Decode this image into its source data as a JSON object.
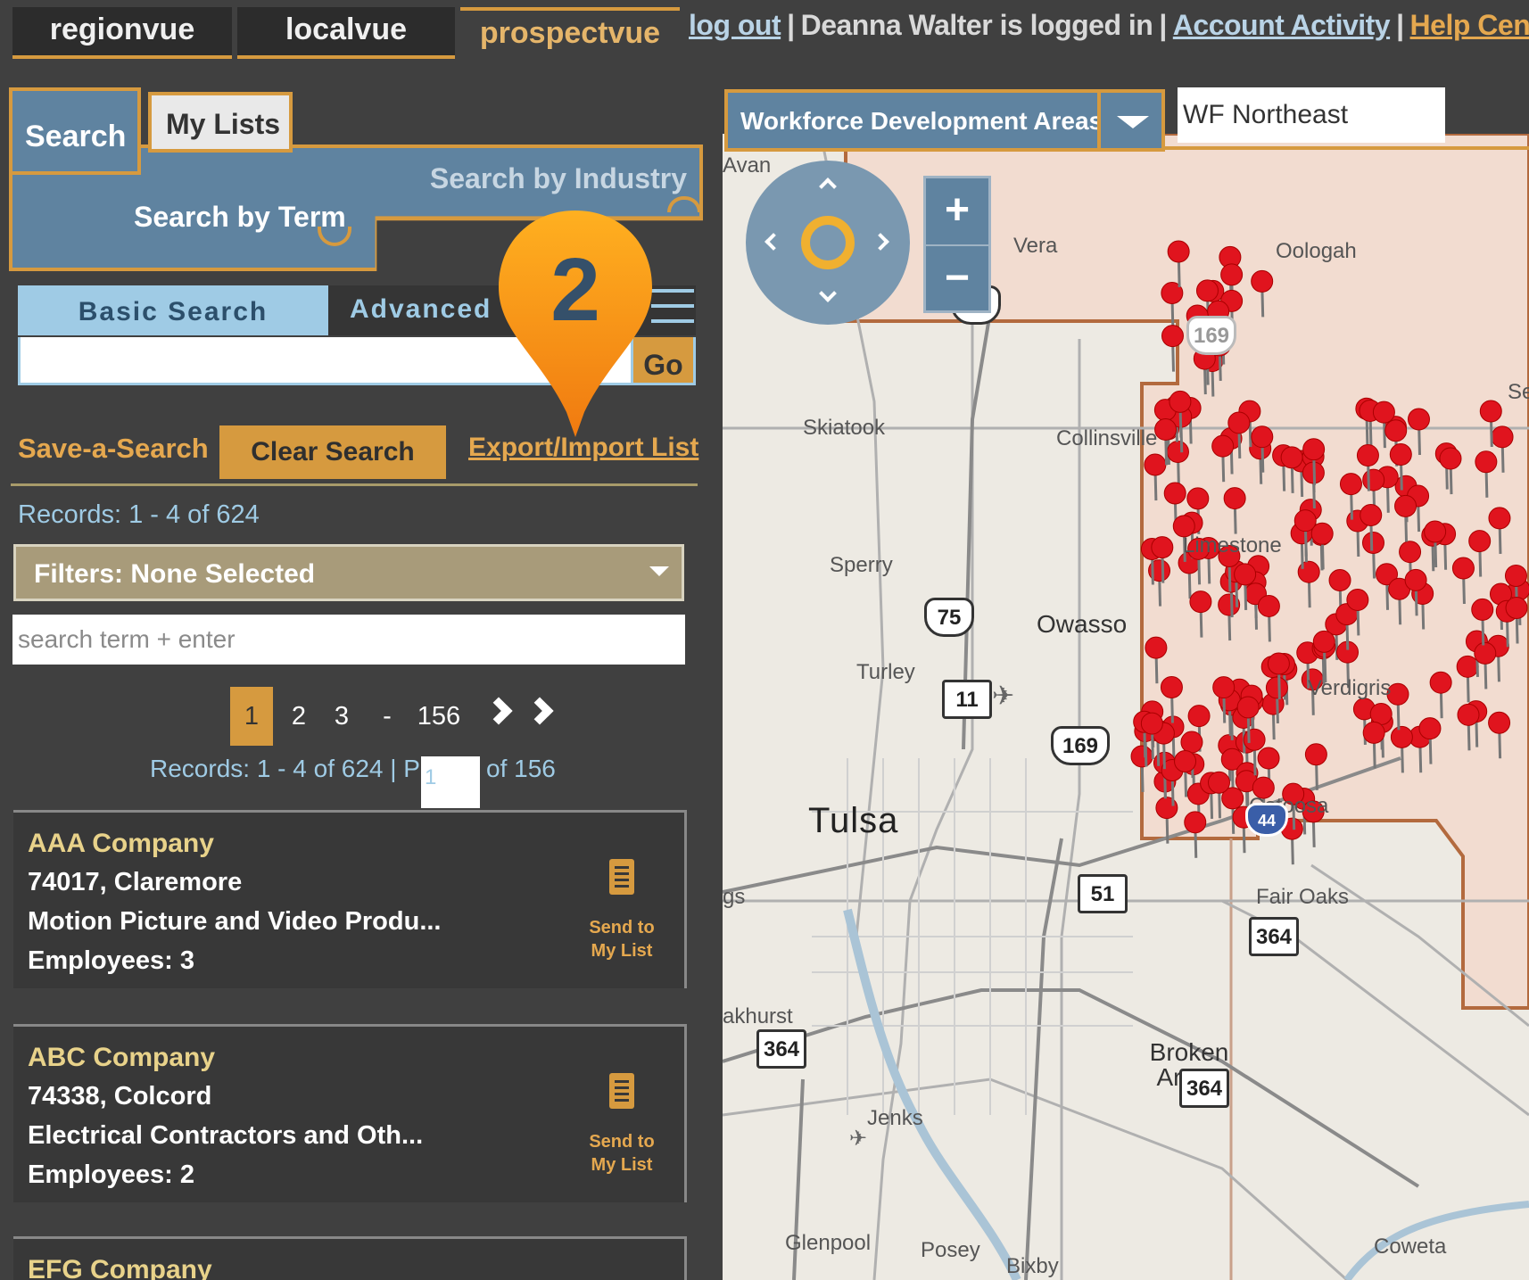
{
  "top_nav": {
    "tabs": [
      {
        "label": "regionvue"
      },
      {
        "label": "localvue"
      },
      {
        "label": "prospectvue"
      }
    ],
    "logout": "log out",
    "user_status": "Deanna Walter is logged in",
    "account_activity": "Account Activity",
    "help_center": "Help Center"
  },
  "panel_tabs": {
    "search": "Search",
    "my_lists": "My Lists"
  },
  "search_modes": {
    "by_industry": "Search by Industry",
    "by_term": "Search by Term"
  },
  "search_type_tabs": {
    "basic": "Basic Search",
    "advanced": "Advanced"
  },
  "search_box": {
    "value": "",
    "go": "Go"
  },
  "actions": {
    "save_search": "Save-a-Search",
    "clear_search": "Clear Search",
    "export_import": "Export/Import List"
  },
  "callout": {
    "number": "2"
  },
  "records_top": "Records: 1 - 4 of 624",
  "filters": {
    "label": "Filters: None Selected"
  },
  "term_input": {
    "placeholder": "search term + enter"
  },
  "pagination": {
    "pages": [
      "1",
      "2",
      "3",
      "-",
      "156"
    ],
    "current": "1"
  },
  "records_line": {
    "text": "Records: 1 - 4 of 624 | Page",
    "page_value": "1",
    "of_text": "of 156"
  },
  "results": [
    {
      "name": "AAA Company",
      "location": "74017, Claremore",
      "industry": "Motion Picture and Video Produ...",
      "employees": "Employees: 3",
      "send_line1": "Send to",
      "send_line2": "My List"
    },
    {
      "name": "ABC Company",
      "location": "74338, Colcord",
      "industry": "Electrical Contractors and Oth...",
      "employees": "Employees: 2",
      "send_line1": "Send to",
      "send_line2": "My List"
    },
    {
      "name": "EFG Company"
    }
  ],
  "map": {
    "region_type": "Workforce Development Areas",
    "region_value": "WF Northeast",
    "zoom_in": "+",
    "zoom_out": "−",
    "places": [
      "Avan",
      "Vera",
      "Skiatook",
      "Collinsville",
      "Sperry",
      "Owasso",
      "Turley",
      "Tulsa",
      "Fair Oaks",
      "Broken Arrow",
      "Jenks",
      "Glenpool",
      "Posey",
      "Coweta",
      "Verdigris",
      "akhurst",
      "gs",
      "Bixby",
      "Seq",
      "Catoosa",
      "Limestone",
      "Oologah"
    ],
    "highways": [
      "75",
      "169",
      "75",
      "11",
      "169",
      "51",
      "364",
      "364",
      "364",
      "44"
    ]
  },
  "colors": {
    "accent": "#d69a3f",
    "panel_blue": "#5f83a0",
    "light_blue": "#9fcbe5",
    "background": "#404040",
    "pin_red": "#e0141e"
  }
}
